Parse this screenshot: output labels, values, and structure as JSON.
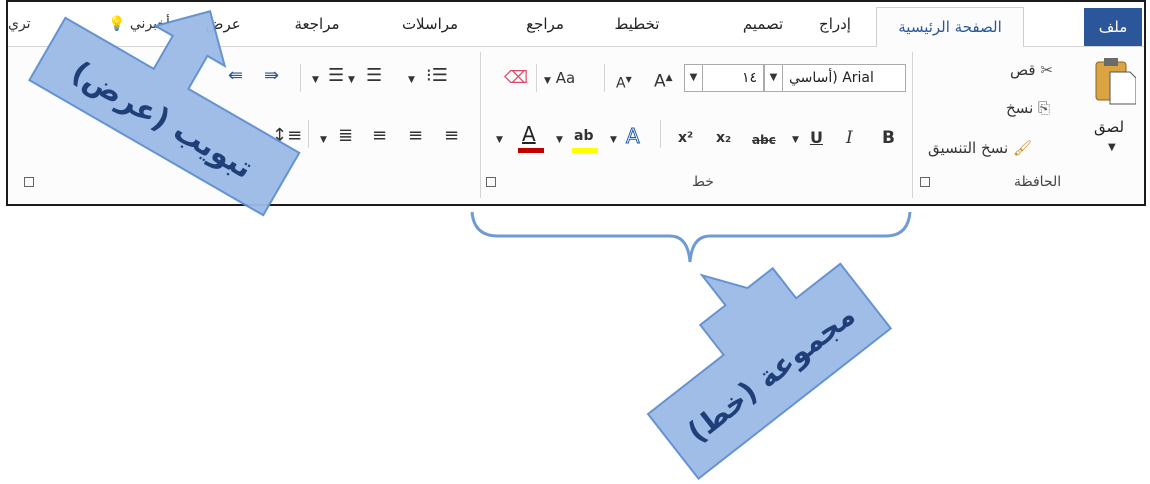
{
  "tabs": {
    "file": "ملف",
    "home": "الصفحة الرئيسية",
    "insert": "إدراج",
    "design": "تصميم",
    "layout": "تخطيط",
    "references": "مراجع",
    "mailings": "مراسلات",
    "review": "مراجعة",
    "view": "عرض",
    "tell_me": "أخبرني",
    "partial": "تري"
  },
  "clipboard": {
    "paste": "لصق",
    "cut": "قص",
    "copy": "نسخ",
    "format_painter": "نسخ التنسيق",
    "group_label": "الحافظة"
  },
  "font": {
    "font_name": "أساسي) Arial",
    "font_size": "١٤",
    "grow": "A",
    "shrink": "A",
    "change_case": "Aa",
    "bold": "B",
    "italic": "I",
    "underline": "U",
    "strikethrough": "abc",
    "subscript": "x₂",
    "superscript": "x²",
    "text_effects": "A",
    "highlight": "ab",
    "font_color": "A",
    "group_label": "خط"
  },
  "callouts": {
    "view_tab": "تبويب (عرض)",
    "font_group": "مجموعة (خط)"
  },
  "colors": {
    "file_tab_bg": "#2b579a",
    "callout_fill": "#9dbbe7",
    "callout_text": "#1f3f78",
    "brace": "#6e9bd6",
    "font_color_bar": "#c00000",
    "highlight_bar": "#ffff00"
  }
}
